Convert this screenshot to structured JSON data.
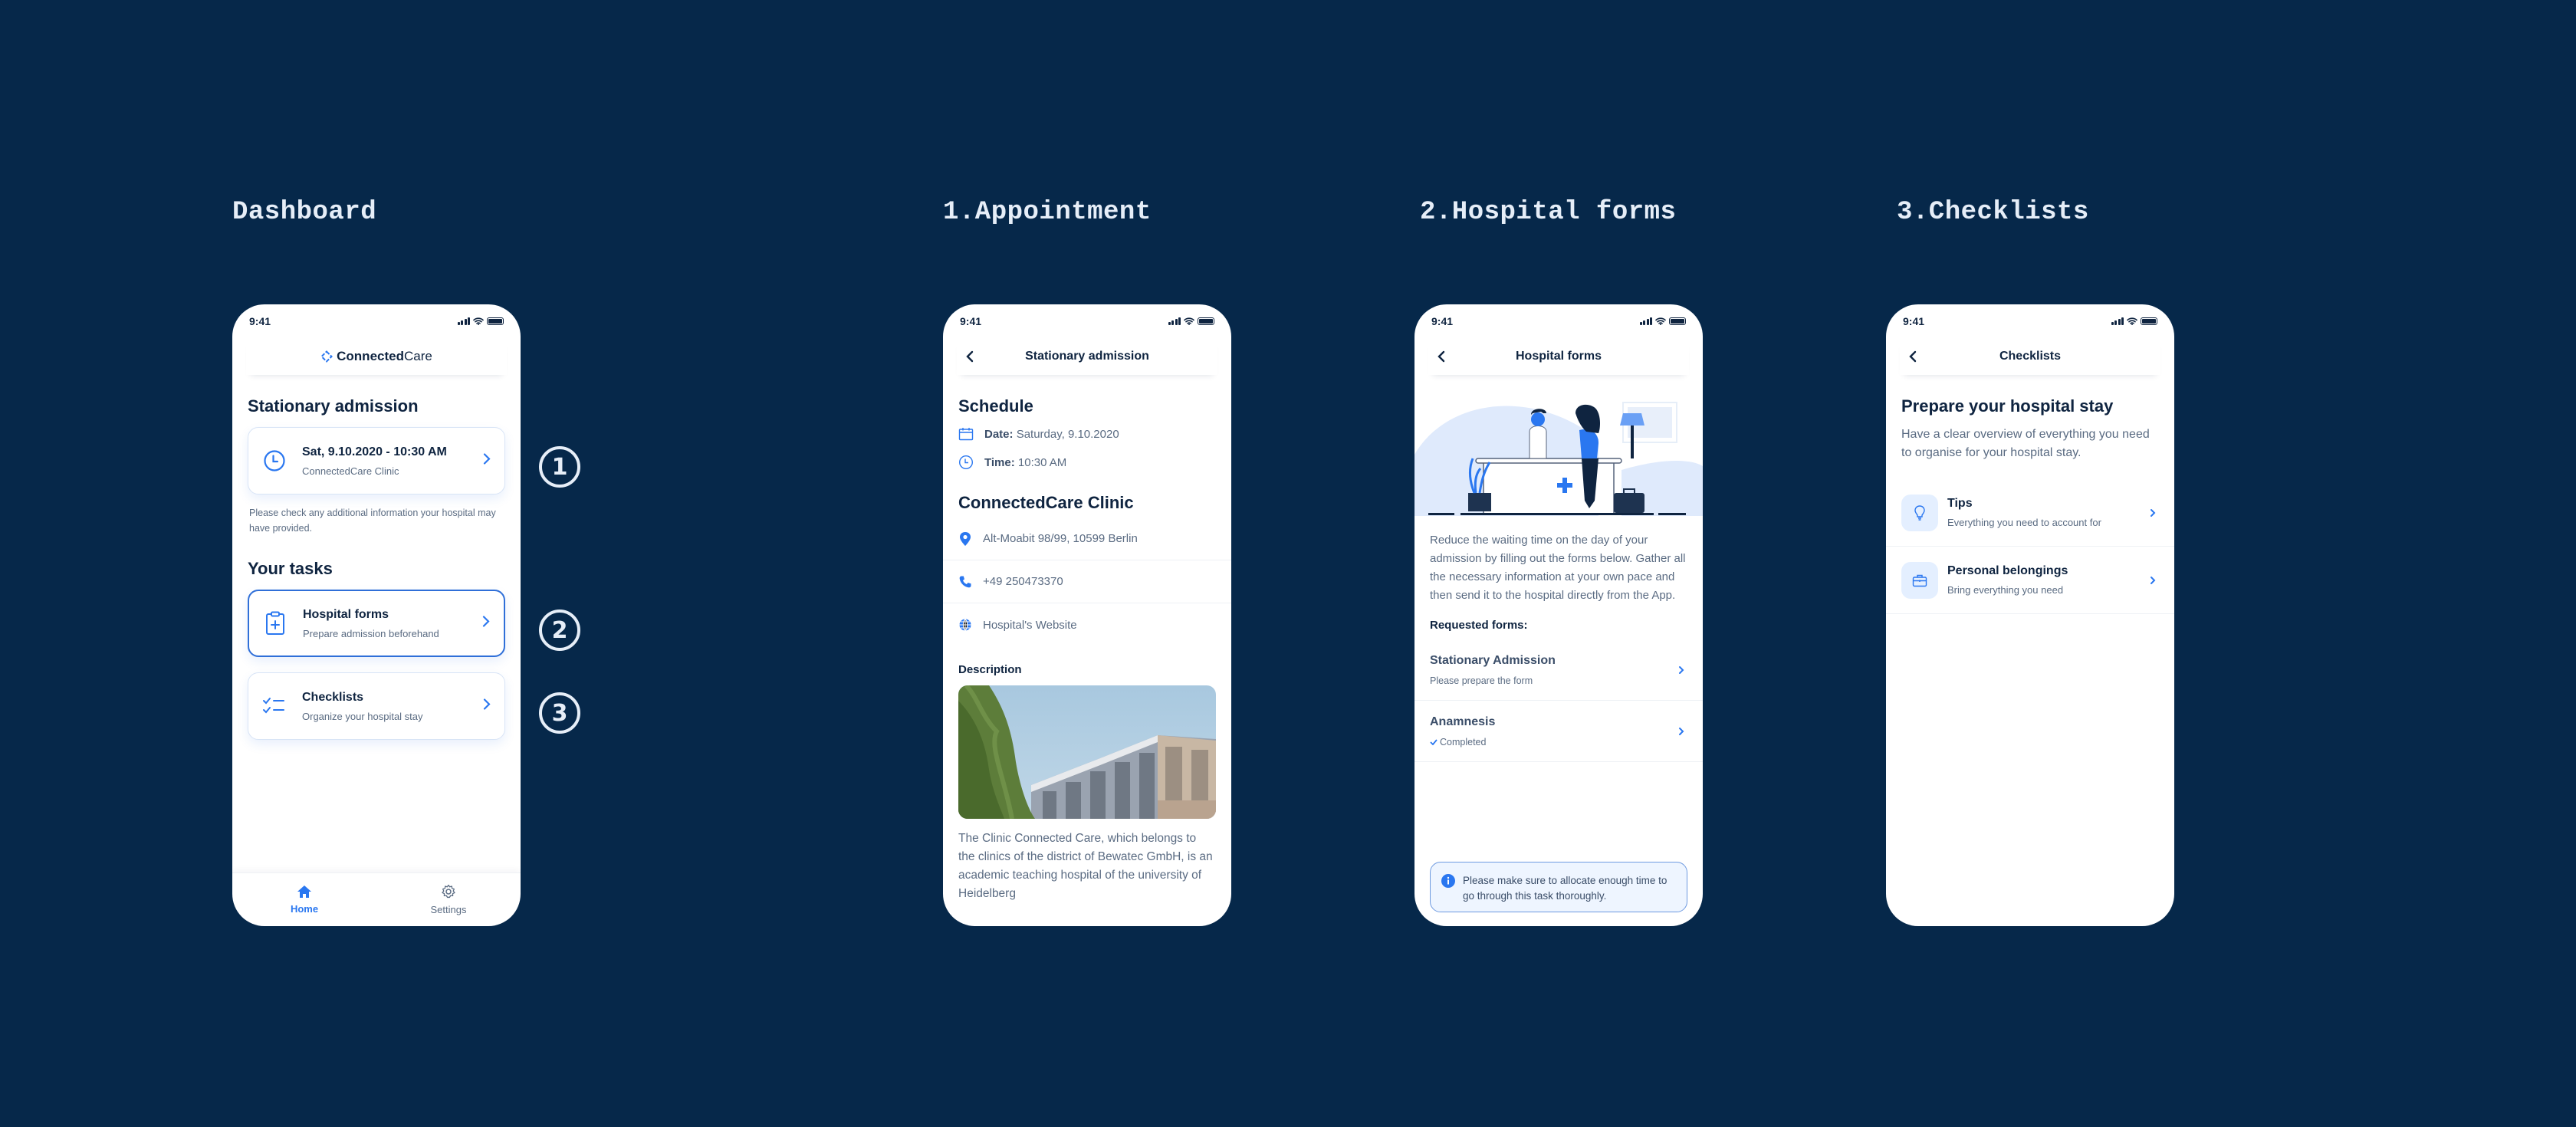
{
  "screens": {
    "dashboard": {
      "label": "Dashboard",
      "status_time": "9:41",
      "logo_bold": "Connected",
      "logo_light": "Care",
      "section_title": "Stationary admission",
      "appointment_card": {
        "title": "Sat, 9.10.2020 - 10:30 AM",
        "subtitle": "ConnectedCare Clinic"
      },
      "note": "Please check any additional information your hospital may have provided.",
      "tasks_title": "Your tasks",
      "tasks": [
        {
          "title": "Hospital forms",
          "subtitle": "Prepare admission beforehand",
          "icon": "clipboard-plus-icon"
        },
        {
          "title": "Checklists",
          "subtitle": "Organize your hospital stay",
          "icon": "checklist-icon"
        }
      ],
      "tabbar": [
        {
          "label": "Home",
          "icon": "home-icon",
          "active": true
        },
        {
          "label": "Settings",
          "icon": "gear-icon",
          "active": false
        }
      ],
      "badges": [
        "1",
        "2",
        "3"
      ]
    },
    "appointment": {
      "label": "1.Appointment",
      "status_time": "9:41",
      "nav_title": "Stationary admission",
      "schedule_title": "Schedule",
      "date_label": "Date:",
      "date_value": "Saturday, 9.10.2020",
      "time_label": "Time:",
      "time_value": "10:30 AM",
      "clinic_title": "ConnectedCare Clinic",
      "address": "Alt-Moabit 98/99, 10599 Berlin",
      "phone": "+49 250473370",
      "website": "Hospital's Website",
      "description_title": "Description",
      "description_text": "The Clinic Connected Care, which belongs to the clinics of the district of Bewatec GmbH, is an academic teaching hospital of the university of Heidelberg"
    },
    "hospital_forms": {
      "label": "2.Hospital forms",
      "status_time": "9:41",
      "nav_title": "Hospital forms",
      "intro": "Reduce the waiting time on the day of your admission by filling out the forms below. Gather all the necessary information at your own pace and then send it to the hospital directly from the App.",
      "requested_title": "Requested forms:",
      "forms": [
        {
          "title": "Stationary Admission",
          "status": "Please prepare the form",
          "completed": false
        },
        {
          "title": "Anamnesis",
          "status": "Completed",
          "completed": true
        }
      ],
      "alert": "Please make sure to allocate enough time to go through this task thoroughly."
    },
    "checklists": {
      "label": "3.Checklists",
      "status_time": "9:41",
      "nav_title": "Checklists",
      "heading": "Prepare your hospital stay",
      "intro": "Have a clear overview of everything you need to organise for your hospital stay.",
      "items": [
        {
          "title": "Tips",
          "subtitle": "Everything you need to account for",
          "icon": "lightbulb-icon"
        },
        {
          "title": "Personal belongings",
          "subtitle": "Bring everything you need",
          "icon": "briefcase-icon"
        }
      ]
    }
  },
  "colors": {
    "background": "#06284a",
    "accent": "#2a77f0",
    "text_dark": "#0f2440",
    "text_muted": "#5a6b82"
  }
}
